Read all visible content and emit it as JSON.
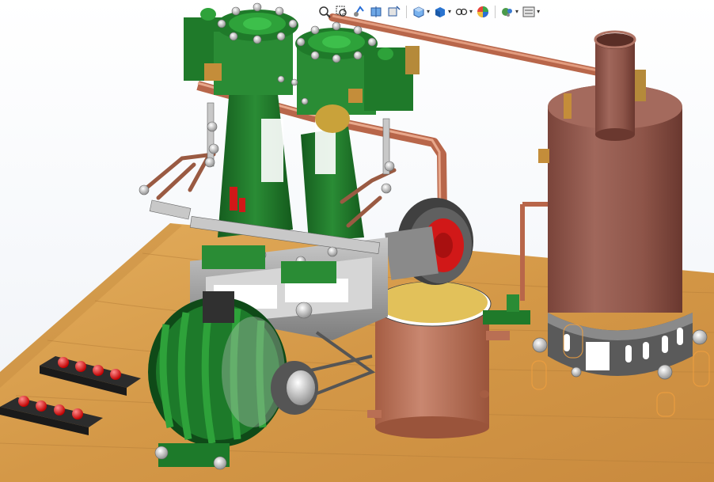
{
  "viewport": {
    "background": "#ffffff",
    "colors": {
      "wood": "#d9a052",
      "frame_green": "#1f7a2a",
      "copper_pipe": "#c4744f",
      "boiler": "#8e5549",
      "boiler_base": "#5a5a5a",
      "tank_lid": "#e2c15a",
      "tank_body": "#b96f54",
      "indicator_red": "#e01010",
      "flywheel_red": "#d11818"
    }
  },
  "heads_up_toolbar": {
    "buttons": [
      {
        "icon": "zoom-to-fit-icon",
        "has_menu": false
      },
      {
        "icon": "zoom-to-area-icon",
        "has_menu": false
      },
      {
        "icon": "previous-view-icon",
        "has_menu": false
      },
      {
        "icon": "section-view-icon",
        "has_menu": false
      },
      {
        "icon": "dynamic-annotation-views-icon",
        "has_menu": false
      },
      {
        "icon": "view-orientation-icon",
        "has_menu": true
      },
      {
        "icon": "display-style-icon",
        "has_menu": true
      },
      {
        "icon": "hide-show-items-icon",
        "has_menu": true
      },
      {
        "icon": "edit-appearance-icon",
        "has_menu": false
      },
      {
        "icon": "apply-scene-icon",
        "has_menu": true
      },
      {
        "icon": "view-settings-icon",
        "has_menu": true
      }
    ]
  }
}
